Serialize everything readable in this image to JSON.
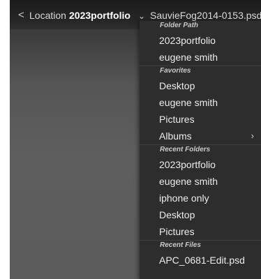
{
  "topbar": {
    "back_icon": "chevron-left-icon",
    "back_glyph": "<",
    "location_label": "Location",
    "current_folder": "2023portfolio",
    "dropdown_icon": "chevron-down-icon",
    "dropdown_glyph": "⌄",
    "filename": "SauvieFog2014-0153.psd"
  },
  "menu": {
    "folder_path": {
      "header": "Folder Path",
      "items": [
        "2023portfolio",
        "eugene smith"
      ]
    },
    "favorites": {
      "header": "Favorites",
      "items": [
        "Desktop",
        "eugene smith",
        "Pictures"
      ]
    },
    "albums": {
      "label": "Albums",
      "submenu_icon": "chevron-right-icon",
      "submenu_glyph": "›"
    },
    "recent_folders": {
      "header": "Recent Folders",
      "items": [
        "2023portfolio",
        "eugene smith",
        "iphone only",
        "Desktop",
        "Pictures"
      ]
    },
    "recent_files": {
      "header": "Recent Files",
      "items": [
        "APC_0681-Edit.psd"
      ]
    }
  }
}
